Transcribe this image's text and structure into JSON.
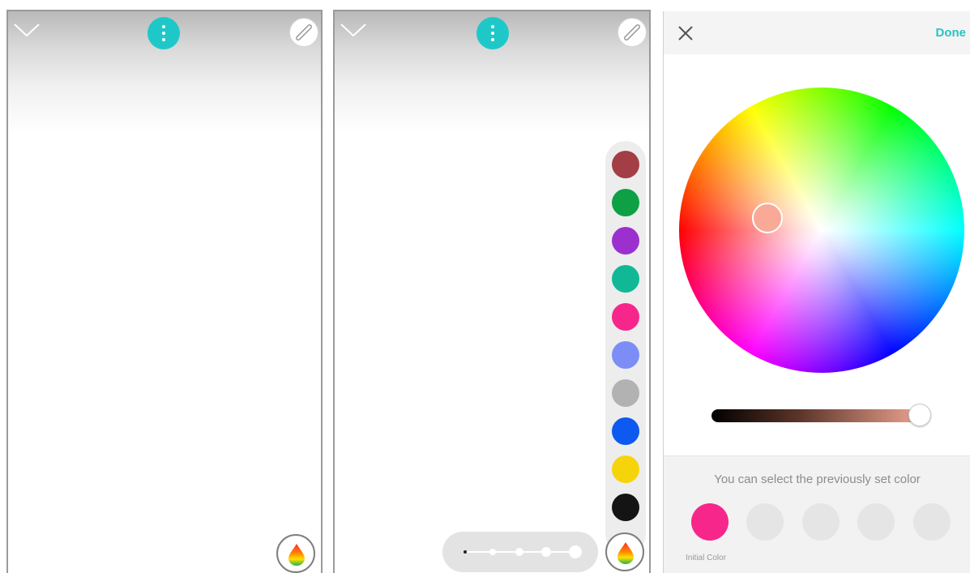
{
  "screens": {
    "drawing": {
      "collapse_icon": "chevron-down-icon",
      "menu_icon": "more-vertical-icon",
      "pen_icon": "pen-icon",
      "color_icon": "color-drop-icon"
    },
    "palette": {
      "swatches": [
        {
          "name": "dark-red",
          "color": "#a33e46"
        },
        {
          "name": "green",
          "color": "#0ea044"
        },
        {
          "name": "purple",
          "color": "#9b30cf"
        },
        {
          "name": "teal",
          "color": "#10b896"
        },
        {
          "name": "pink",
          "color": "#f7268b"
        },
        {
          "name": "periwinkle",
          "color": "#7c8ef6"
        },
        {
          "name": "gray",
          "color": "#b2b2b2"
        },
        {
          "name": "blue",
          "color": "#0e59f0"
        },
        {
          "name": "yellow",
          "color": "#f6d40c"
        },
        {
          "name": "black",
          "color": "#141414"
        }
      ],
      "thickness_levels": 5,
      "selected_thickness": 5
    },
    "color_picker": {
      "done_label": "Done",
      "close_icon": "close-icon",
      "selected_color": "#f8aa96",
      "brightness": 0.97,
      "recent_message": "You can select the previously set color",
      "initial_color": "#f7268b",
      "initial_color_label": "Initial Color",
      "empty_slots": 4
    }
  },
  "colors": {
    "accent": "#1fc8c8",
    "done_text": "#27c3c3"
  }
}
